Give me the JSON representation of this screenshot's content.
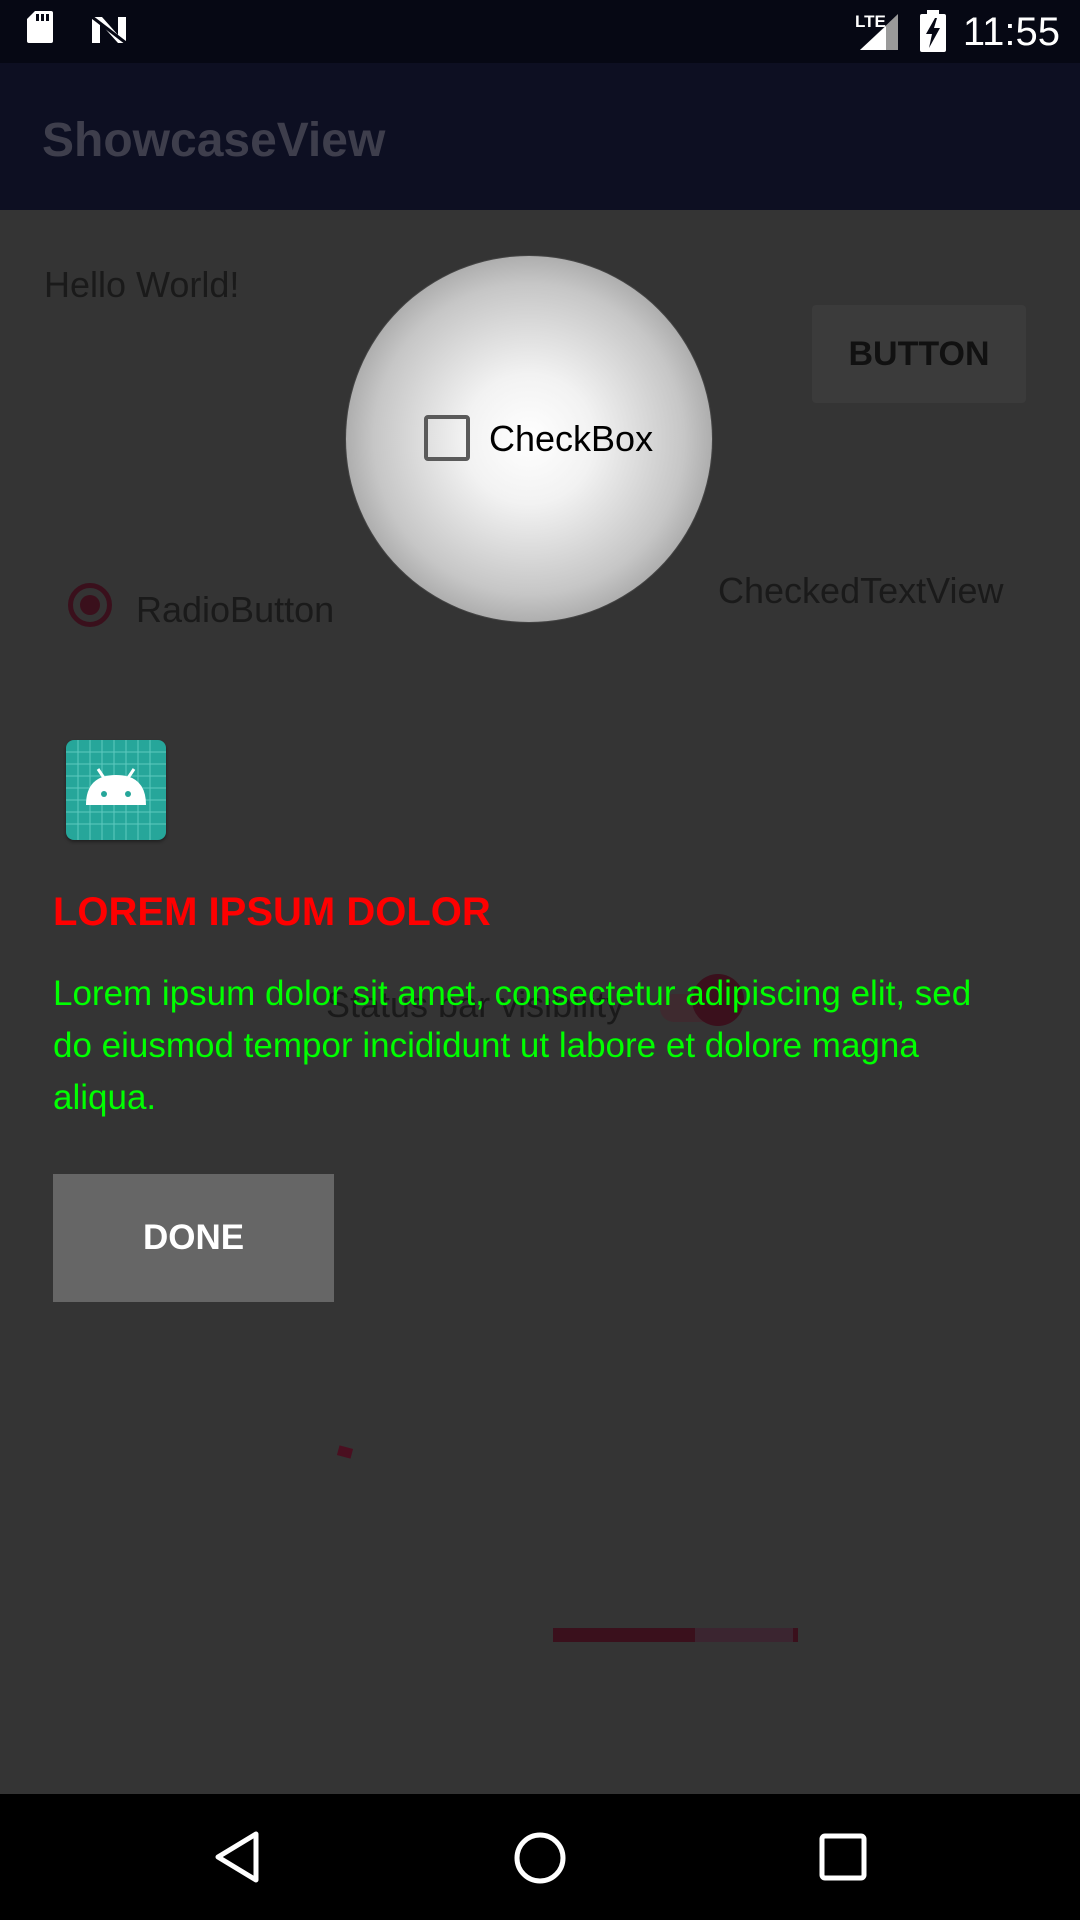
{
  "status_bar": {
    "time": "11:55",
    "network_label": "LTE",
    "icons": [
      "sd-card-icon",
      "n-notification-icon",
      "lte-signal-icon",
      "battery-charging-icon"
    ]
  },
  "app_bar": {
    "title": "ShowcaseView"
  },
  "content": {
    "hello_text": "Hello World!",
    "button_label": "BUTTON",
    "checkbox_label": "CheckBox",
    "radio_label": "RadioButton",
    "checked_text_view": "CheckedTextView",
    "switch_label": "Status bar visibility",
    "progress_value": 0.58
  },
  "showcase": {
    "title": "LOREM IPSUM DOLOR",
    "text": "Lorem ipsum dolor sit amet, consectetur adipiscing elit, sed do eiusmod tempor incididunt ut labore et dolore magna aliqua.",
    "done_label": "DONE",
    "title_color": "#ff0000",
    "text_color": "#00ff00"
  },
  "nav_bar": {
    "buttons": [
      "back-icon",
      "home-icon",
      "recents-icon"
    ]
  }
}
